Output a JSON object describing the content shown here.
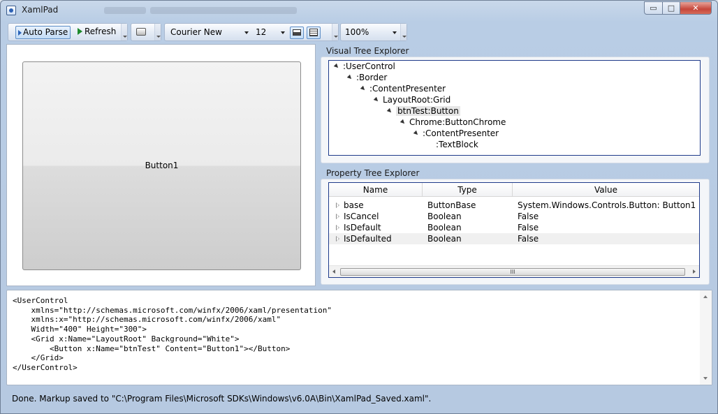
{
  "window": {
    "title": "XamlPad"
  },
  "caption_buttons": {
    "minimize": "▭",
    "maximize": "□",
    "close": "✕"
  },
  "toolbar": {
    "auto_parse_label": "Auto Parse",
    "refresh_label": "Refresh",
    "font_family": "Courier New",
    "font_size": "12",
    "zoom": "100%"
  },
  "preview": {
    "button_content": "Button1"
  },
  "visual_tree": {
    "title": "Visual Tree Explorer",
    "nodes": [
      {
        "label": ":UserControl"
      },
      {
        "label": ":Border"
      },
      {
        "label": ":ContentPresenter"
      },
      {
        "label": "LayoutRoot:Grid"
      },
      {
        "label": "btnTest:Button"
      },
      {
        "label": "Chrome:ButtonChrome"
      },
      {
        "label": ":ContentPresenter"
      },
      {
        "label": ":TextBlock"
      }
    ]
  },
  "property_tree": {
    "title": "Property Tree Explorer",
    "columns": [
      "Name",
      "Type",
      "Value"
    ],
    "rows": [
      {
        "name": "base",
        "type": "ButtonBase",
        "value": "System.Windows.Controls.Button: Button1"
      },
      {
        "name": "IsCancel",
        "type": "Boolean",
        "value": "False"
      },
      {
        "name": "IsDefault",
        "type": "Boolean",
        "value": "False"
      },
      {
        "name": "IsDefaulted",
        "type": "Boolean",
        "value": "False"
      }
    ],
    "scroll_thumb_grip": "III"
  },
  "editor": {
    "lines": [
      "<UserControl",
      "    xmlns=\"http://schemas.microsoft.com/winfx/2006/xaml/presentation\"",
      "    xmlns:x=\"http://schemas.microsoft.com/winfx/2006/xaml\"",
      "    Width=\"400\" Height=\"300\">",
      "    <Grid x:Name=\"LayoutRoot\" Background=\"White\">",
      "        <Button x:Name=\"btnTest\" Content=\"Button1\"></Button>",
      "    </Grid>",
      "</UserControl>"
    ]
  },
  "status": {
    "text": "Done. Markup saved to \"C:\\Program Files\\Microsoft SDKs\\Windows\\v6.0A\\Bin\\XamlPad_Saved.xaml\"."
  },
  "colors": {
    "accent": "#1e3a8a",
    "window_bg": "#b9cde5",
    "close_red": "#c6463a"
  },
  "icons": {
    "app": "xamlpad-app-icon",
    "refresh": "play-arrow-icon",
    "print": "printer-icon",
    "toggle_preview": "preview-pane-icon",
    "toggle_tree": "tree-view-icon"
  }
}
